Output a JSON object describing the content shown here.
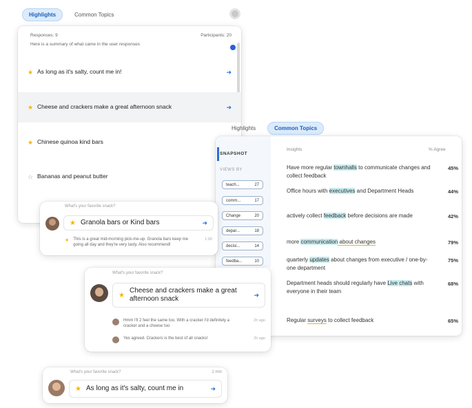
{
  "top_tabs": {
    "highlights": "Highlights",
    "common_topics": "Common Topics"
  },
  "main_card": {
    "responses": "Responses: 9",
    "participants": "Participants: 20",
    "subtitle": "Here is a summary of what came in the user responses",
    "items": [
      {
        "text": "As long as it's salty, count me in!",
        "starred": true
      },
      {
        "text": "Cheese and crackers make a great afternoon snack",
        "starred": true
      },
      {
        "text": "Chinese quinoa kind bars",
        "starred": true
      },
      {
        "text": "Bananas and peanut butter",
        "starred": false
      }
    ]
  },
  "topics_panel": {
    "tabs": {
      "highlights": "Highlights",
      "common_topics": "Common Topics"
    },
    "snapshot_title": "SNAPSHOT",
    "views_label": "VIEWS BY",
    "chips": [
      {
        "label": "teach...",
        "count": "27"
      },
      {
        "label": "comm...",
        "count": "17"
      },
      {
        "label": "Change",
        "count": "20"
      },
      {
        "label": "depar...",
        "count": "18"
      },
      {
        "label": "decisi...",
        "count": "14"
      },
      {
        "label": "feedba...",
        "count": "10"
      }
    ],
    "col_header": "Insights",
    "col_header_right": "% Agree",
    "insights": [
      {
        "pre": "Have more regular ",
        "hl": "townhalls",
        "post": " to communicate changes and collect feedback",
        "pct": "45%"
      },
      {
        "pre": "Office hours with ",
        "hl": "executives",
        "post": " and Department Heads",
        "pct": "44%"
      },
      {
        "pre": "actively collect ",
        "hl": "feedback",
        "post": " before decisions are made",
        "pct": "42%"
      },
      {
        "pre": "more ",
        "hl": "communication",
        "post": " about changes",
        "pct": "79%"
      },
      {
        "pre": "quarterly ",
        "hl": "updates",
        "post": " about changes from executive / one-by-one department",
        "pct": "75%"
      },
      {
        "pre": "Department heads should regularly have ",
        "hl": "Live chats",
        "post": " with everyone in their team",
        "pct": "68%"
      },
      {
        "pre": "Regular ",
        "hl": "surveys",
        "post": " to collect feedback",
        "pct": "65%"
      }
    ]
  },
  "card_a": {
    "question": "What's your favorite snack?",
    "answer": "Granola bars or Kind bars",
    "sub_text": "This is a great mid-morning pick-me-up. Granola bars keep me going all day and they're very tasty. Also recommend!",
    "sub_meta": "1:00"
  },
  "card_b": {
    "question": "What's your favorite snack?",
    "answer": "Cheese and crackers make a great afternoon snack",
    "replies": [
      {
        "text": "Hmm I'll 2 feel the same too. With a cracker I'd definitely a cracker and a cheese too",
        "meta": "2h ago"
      },
      {
        "text": "Yes agreed. Crackers is the best of all snacks!",
        "meta": "2h ago"
      }
    ]
  },
  "card_c": {
    "question": "What's your favorite snack?",
    "answer": "As long as it's salty, count me in",
    "meta": "1 min"
  },
  "icons": {
    "star": "★",
    "star_hollow": "☆",
    "arrow": "➜",
    "gear": "gear-icon"
  },
  "colors": {
    "accent": "#2b6fd6",
    "star": "#f2b705",
    "highlight": "#c9ecef",
    "underline": "#f0a93a"
  }
}
